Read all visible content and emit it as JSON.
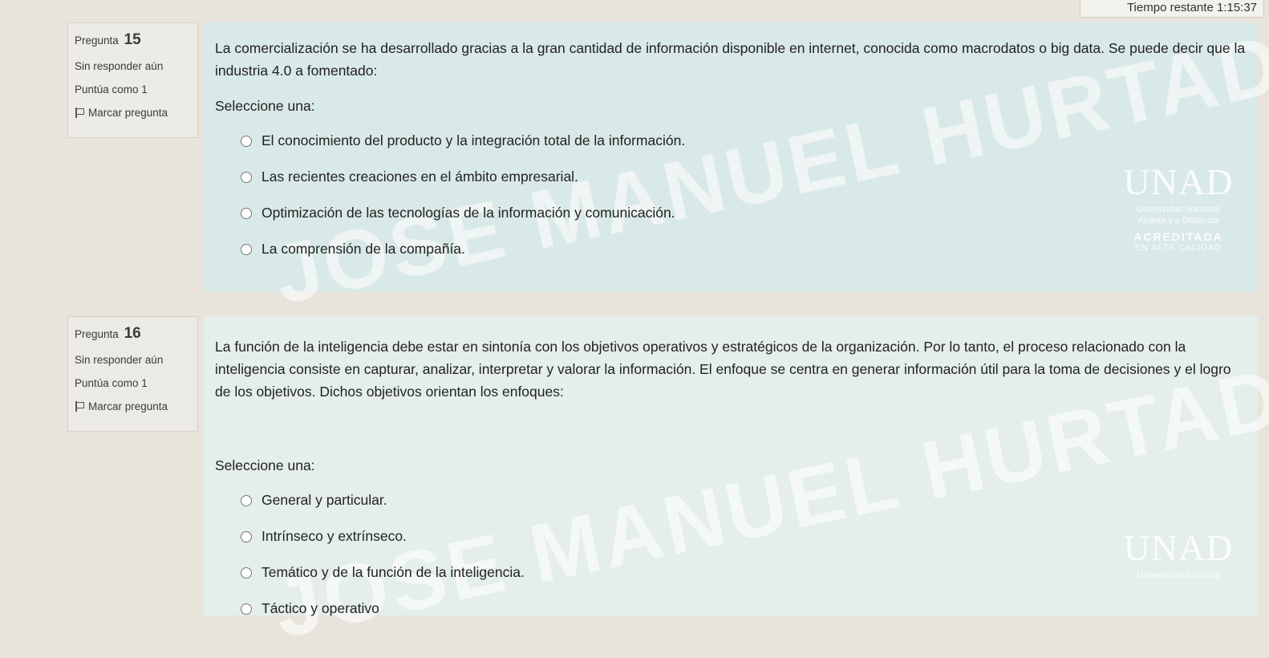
{
  "timer": {
    "label": "Tiempo restante",
    "value": "1:15:37"
  },
  "q15": {
    "label": "Pregunta",
    "number": "15",
    "status": "Sin responder aún",
    "score": "Puntúa como 1",
    "flag_label": "Marcar pregunta",
    "text": "La comercialización se ha desarrollado gracias a la gran cantidad de información disponible en internet, conocida como macrodatos o big data. Se puede decir que la industria 4.0 a fomentado:",
    "prompt": "Seleccione una:",
    "options": [
      "El conocimiento del producto y la integración total de la información.",
      "Las recientes creaciones en el ámbito empresarial.",
      "Optimización de las tecnologías de la información y comunicación.",
      "La comprensión de la compañía."
    ],
    "watermark": "JOSE MANUEL HURTADO GODOY"
  },
  "q16": {
    "label": "Pregunta",
    "number": "16",
    "status": "Sin responder aún",
    "score": "Puntúa como 1",
    "flag_label": "Marcar pregunta",
    "text": "La función de la inteligencia debe estar en sintonía con los objetivos operativos y estratégicos de la organización. Por lo tanto, el proceso relacionado con la inteligencia consiste en capturar, analizar, interpretar y valorar la información. El enfoque se centra en generar información útil para la toma de decisiones y el logro de los objetivos. Dichos objetivos orientan los enfoques:",
    "prompt": "Seleccione una:",
    "options": [
      "General y particular.",
      "Intrínseco y extrínseco.",
      "Temático y de la función de la inteligencia.",
      "Táctico y operativo"
    ],
    "watermark": "JOSE MANUEL HURTADO GODOY"
  },
  "logo": {
    "name": "UNAD",
    "subtitle_1": "Universidad Nacional",
    "subtitle_2": "Abierta y a Distancia",
    "accreditation": "ACREDITADA",
    "quality": "EN ALTA CALIDAD"
  },
  "colors": {
    "page_bg": "#e8e4dc",
    "question_bg": "#d9e9e7",
    "info_bg": "#edebe6"
  }
}
